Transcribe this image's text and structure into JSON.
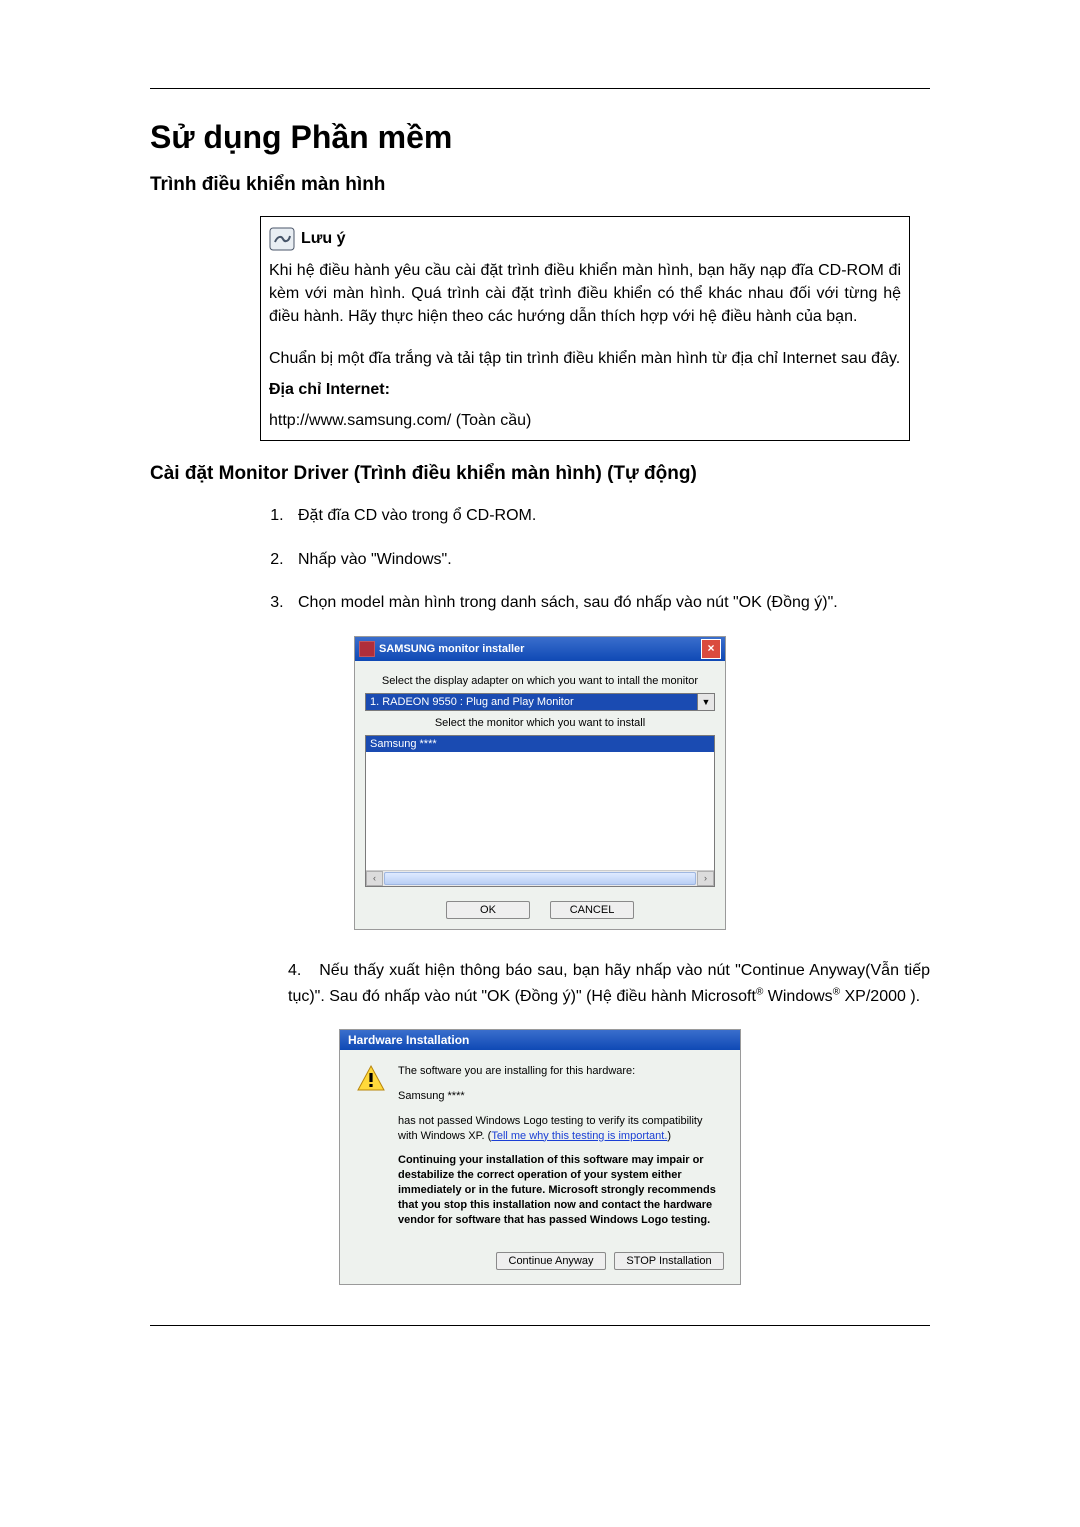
{
  "title": "Sử dụng Phần mềm",
  "section1": "Trình điều khiển màn hình",
  "note": {
    "label": "Lưu ý",
    "p1": "Khi hệ điều hành yêu cầu cài đặt trình điều khiển màn hình, bạn hãy nạp đĩa CD-ROM đi kèm với màn hình. Quá trình cài đặt trình điều khiển có thể khác nhau đối với từng hệ điều hành. Hãy thực hiện theo các hướng dẫn thích hợp với hệ điều hành của bạn.",
    "p2": "Chuẩn bị một đĩa trắng và tải tập tin trình điều khiển màn hình từ địa chỉ Internet sau đây.",
    "addr_label": "Địa chỉ Internet:",
    "addr": "http://www.samsung.com/ (Toàn cầu)"
  },
  "section2": "Cài đặt Monitor Driver (Trình điều khiển màn hình) (Tự động)",
  "steps": {
    "s1": "Đặt đĩa CD vào trong ổ CD-ROM.",
    "s2": "Nhấp vào \"Windows\".",
    "s3": "Chọn model màn hình trong danh sách, sau đó nhấp vào nút \"OK (Đồng ý)\"."
  },
  "dlg1": {
    "title": "SAMSUNG monitor installer",
    "line1": "Select the display adapter on which you want to intall the monitor",
    "combo": "1. RADEON 9550 : Plug and Play Monitor",
    "line2": "Select the monitor which you want to install",
    "list_item": "Samsung ****",
    "ok": "OK",
    "cancel": "CANCEL"
  },
  "step4_num": "4.",
  "step4_text_a": "Nếu thấy xuất hiện thông báo sau, bạn hãy nhấp vào nút \"Continue Anyway(Vẫn tiếp tục)\". Sau đó nhấp vào nút \"OK (Đồng ý)\" (Hệ điều hành Microsoft",
  "step4_text_b": " Windows",
  "step4_text_c": " XP/2000 ).",
  "dlg2": {
    "title": "Hardware Installation",
    "p1": "The software you are installing for this hardware:",
    "p2": "Samsung ****",
    "p3a": "has not passed Windows Logo testing to verify its compatibility with Windows XP. (",
    "p3link": "Tell me why this testing is important.",
    "p3b": ")",
    "p4": "Continuing your installation of this software may impair or destabilize the correct operation of your system either immediately or in the future. Microsoft strongly recommends that you stop this installation now and contact the hardware vendor for software that has passed Windows Logo testing.",
    "btn_continue": "Continue Anyway",
    "btn_stop": "STOP Installation"
  }
}
